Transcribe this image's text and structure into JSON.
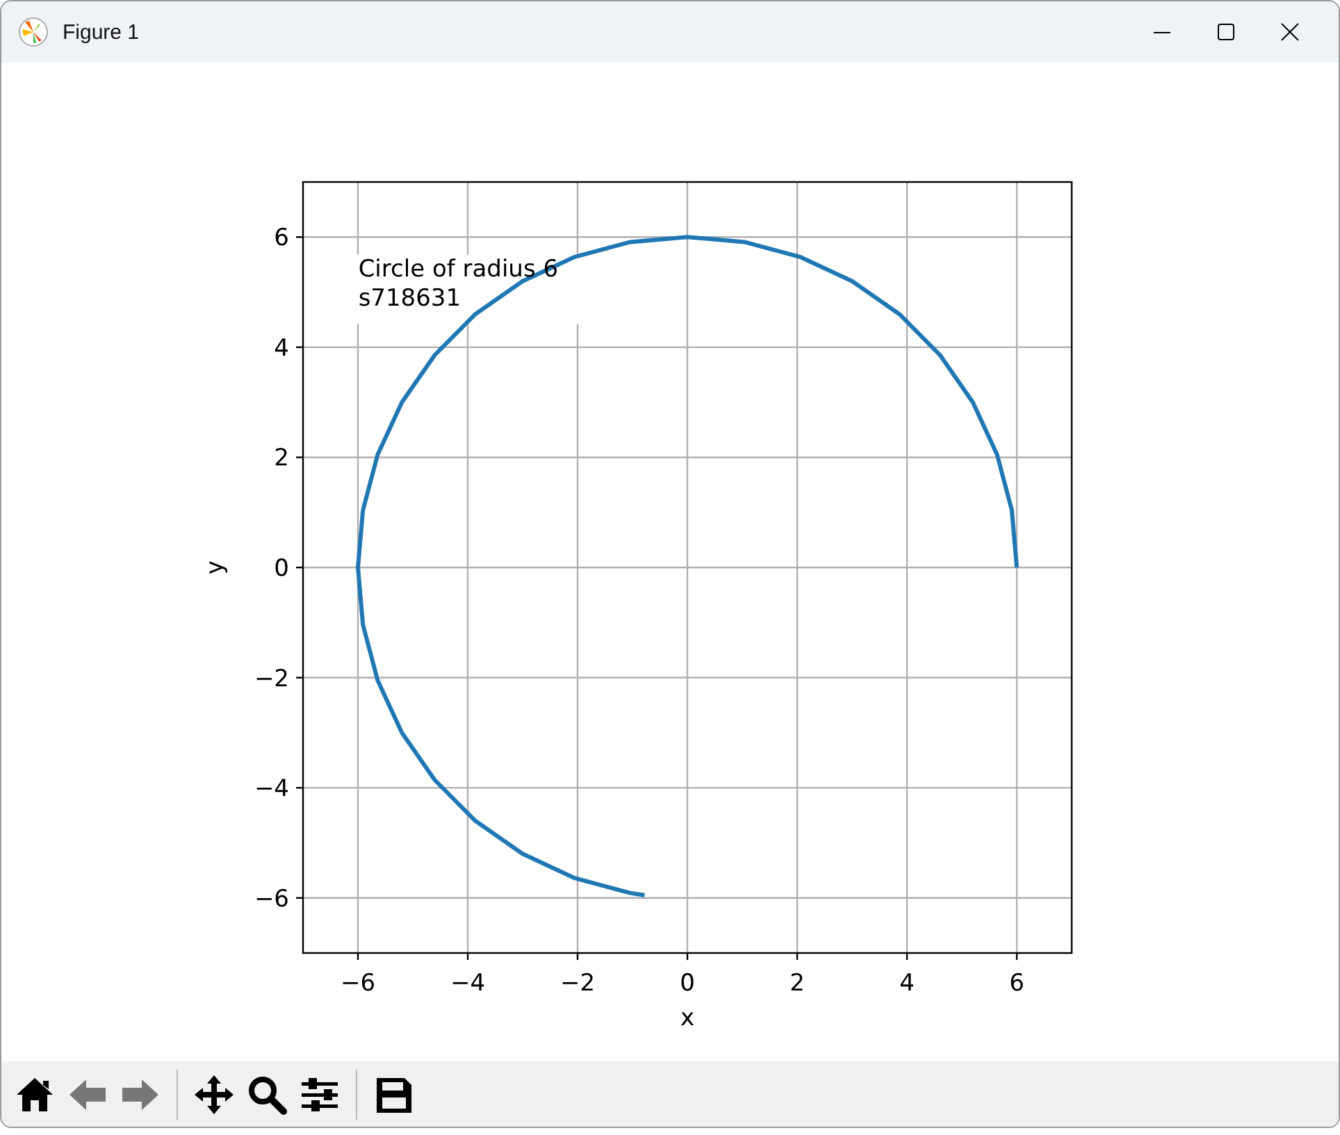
{
  "window": {
    "title": "Figure 1"
  },
  "chart_data": {
    "type": "line",
    "xlabel": "x",
    "ylabel": "y",
    "x": [
      6,
      5.91,
      5.64,
      5.2,
      4.6,
      3.86,
      3,
      2.05,
      1.04,
      0,
      -1.04,
      -2.05,
      -3,
      -3.86,
      -4.6,
      -5.2,
      -5.64,
      -5.91,
      -6,
      -5.91,
      -5.64,
      -5.2,
      -4.6,
      -3.86,
      -3,
      -2.05,
      -1.04,
      -0.78
    ],
    "series": [
      {
        "color": "#1f77b4",
        "values": [
          0,
          1.04,
          2.05,
          3,
          3.86,
          4.6,
          5.2,
          5.64,
          5.91,
          6,
          5.91,
          5.64,
          5.2,
          4.6,
          3.86,
          3,
          2.05,
          1.04,
          0,
          -1.04,
          -2.05,
          -3,
          -3.86,
          -4.6,
          -5.2,
          -5.64,
          -5.91,
          -5.95
        ]
      }
    ],
    "xlim": [
      -7,
      7
    ],
    "ylim": [
      -7,
      7
    ],
    "xticks": [
      {
        "value": -6,
        "label": "−6"
      },
      {
        "value": -4,
        "label": "−4"
      },
      {
        "value": -2,
        "label": "−2"
      },
      {
        "value": 0,
        "label": "0"
      },
      {
        "value": 2,
        "label": "2"
      },
      {
        "value": 4,
        "label": "4"
      },
      {
        "value": 6,
        "label": "6"
      }
    ],
    "yticks": [
      {
        "value": -6,
        "label": "−6"
      },
      {
        "value": -4,
        "label": "−4"
      },
      {
        "value": -2,
        "label": "−2"
      },
      {
        "value": 0,
        "label": "0"
      },
      {
        "value": 2,
        "label": "2"
      },
      {
        "value": 4,
        "label": "4"
      },
      {
        "value": 6,
        "label": "6"
      }
    ],
    "grid": true,
    "annotations": [
      {
        "text": "Circle of radius 6\ns718631"
      }
    ]
  },
  "toolbar": [
    {
      "kind": "home"
    },
    {
      "kind": "back"
    },
    {
      "kind": "forward"
    },
    {
      "kind": "separator"
    },
    {
      "kind": "pan"
    },
    {
      "kind": "zoom"
    },
    {
      "kind": "configure"
    },
    {
      "kind": "separator"
    },
    {
      "kind": "save"
    }
  ]
}
